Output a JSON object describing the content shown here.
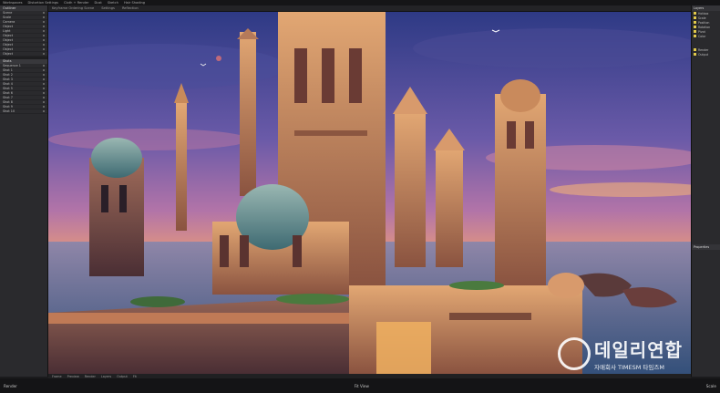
{
  "menubar": {
    "items": [
      "Workspaces",
      "Distortion Settings",
      "Cloth + Render",
      "Dust",
      "Sketch",
      "Hair Shading"
    ]
  },
  "tabbar": {
    "tabs": [
      "Keyframe Ordering Scene",
      "Settings",
      "Reflection"
    ]
  },
  "left_panel": {
    "header": "Outliner",
    "items": [
      "Scene",
      "Scale",
      "Camera",
      "Object",
      "Light",
      "Object",
      "Object",
      "Object",
      "Object",
      "Object"
    ],
    "sub_header": "Shots",
    "sub_items": [
      "Sequence 1",
      "Shot 1",
      "Shot 2",
      "Shot 3",
      "Shot 4",
      "Shot 5",
      "Shot 6",
      "Shot 7",
      "Shot 8",
      "Shot 9",
      "Shot 10"
    ]
  },
  "right_panel": {
    "header": "Layers",
    "items": [
      "Hotbox",
      "Scale",
      "Position",
      "Rotation",
      "Pivot",
      "Color"
    ],
    "footer_items": [
      "Render",
      "Output"
    ],
    "secondary_header": "Properties"
  },
  "bottom_bar": {
    "items": [
      "Frame",
      "Preview",
      "Render",
      "Layers",
      "Output",
      "Fit"
    ]
  },
  "status_bar": {
    "left": "Render",
    "center": "Fit View",
    "right": "Scale"
  },
  "watermark": {
    "title": "데일리연합",
    "subtitle": "자매회사 TIMESM 타임즈M"
  },
  "colors": {
    "sky_top": "#3b4390",
    "sky_mid": "#8a5e9c",
    "sky_horizon": "#e8a36a",
    "stone": "#c88a5a",
    "dome": "#5a8a8a",
    "sea": "#4a5f8a"
  }
}
